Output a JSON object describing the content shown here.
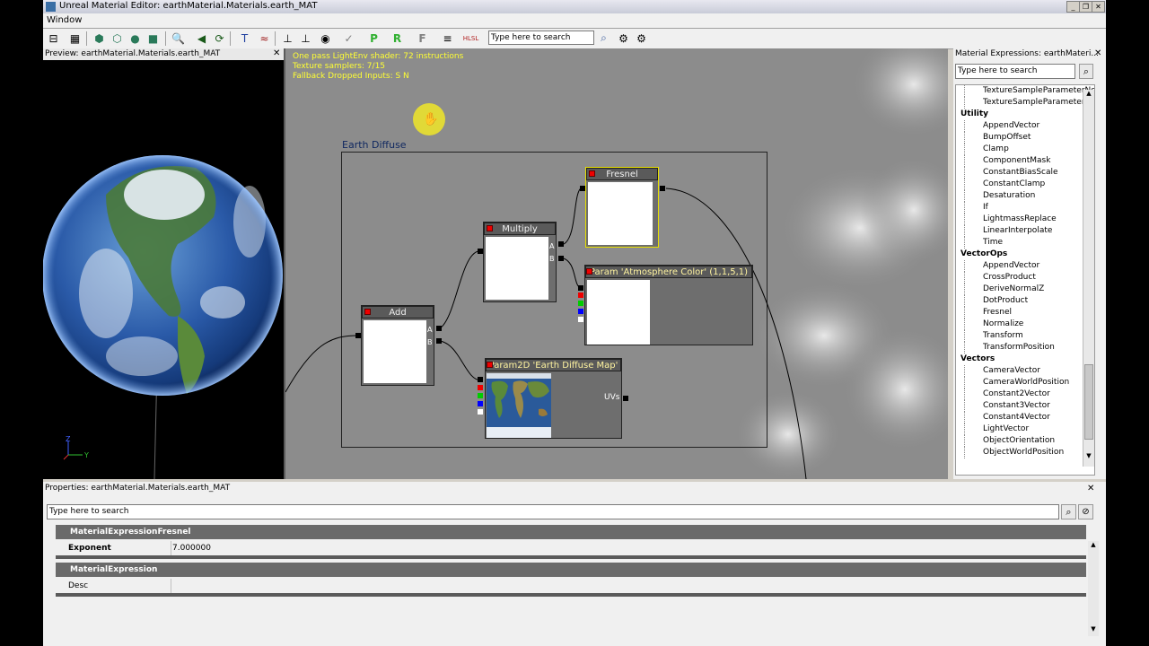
{
  "window": {
    "title": "Unreal Material Editor: earthMaterial.Materials.earth_MAT",
    "menu": [
      "Window"
    ]
  },
  "toolbar": {
    "search_placeholder": "Type here to search"
  },
  "preview": {
    "title": "Preview: earthMaterial.Materials.earth_MAT",
    "axis_z": "Z",
    "axis_y": "Y"
  },
  "graph": {
    "info_lines": [
      "One pass LightEnv shader: 72 instructions",
      "Texture samplers: 7/15",
      "Fallback Dropped Inputs: S N"
    ],
    "comment": "Earth Diffuse",
    "nodes": {
      "fresnel": "Fresnel",
      "multiply": "Multiply",
      "add": "Add",
      "atmos": "Param 'Atmosphere Color' (1,1,5,1)",
      "tex": "Param2D 'Earth Diffuse Map'",
      "tex_uvs": "UVs",
      "pin_a": "A",
      "pin_b": "B"
    }
  },
  "expressions": {
    "title": "Material Expressions: earthMateri...",
    "search_placeholder": "Type here to search",
    "rows": [
      {
        "t": "item",
        "label": "TextureSampleParameterNorm"
      },
      {
        "t": "item",
        "label": "TextureSampleParameterSubU"
      },
      {
        "t": "cat",
        "label": "Utility"
      },
      {
        "t": "item",
        "label": "AppendVector"
      },
      {
        "t": "item",
        "label": "BumpOffset"
      },
      {
        "t": "item",
        "label": "Clamp"
      },
      {
        "t": "item",
        "label": "ComponentMask"
      },
      {
        "t": "item",
        "label": "ConstantBiasScale"
      },
      {
        "t": "item",
        "label": "ConstantClamp"
      },
      {
        "t": "item",
        "label": "Desaturation"
      },
      {
        "t": "item",
        "label": "If"
      },
      {
        "t": "item",
        "label": "LightmassReplace"
      },
      {
        "t": "item",
        "label": "LinearInterpolate"
      },
      {
        "t": "item",
        "label": "Time"
      },
      {
        "t": "cat",
        "label": "VectorOps"
      },
      {
        "t": "item",
        "label": "AppendVector"
      },
      {
        "t": "item",
        "label": "CrossProduct"
      },
      {
        "t": "item",
        "label": "DeriveNormalZ"
      },
      {
        "t": "item",
        "label": "DotProduct"
      },
      {
        "t": "item",
        "label": "Fresnel"
      },
      {
        "t": "item",
        "label": "Normalize"
      },
      {
        "t": "item",
        "label": "Transform"
      },
      {
        "t": "item",
        "label": "TransformPosition"
      },
      {
        "t": "cat",
        "label": "Vectors"
      },
      {
        "t": "item",
        "label": "CameraVector"
      },
      {
        "t": "item",
        "label": "CameraWorldPosition"
      },
      {
        "t": "item",
        "label": "Constant2Vector"
      },
      {
        "t": "item",
        "label": "Constant3Vector"
      },
      {
        "t": "item",
        "label": "Constant4Vector"
      },
      {
        "t": "item",
        "label": "LightVector"
      },
      {
        "t": "item",
        "label": "ObjectOrientation"
      },
      {
        "t": "item",
        "label": "ObjectWorldPosition"
      }
    ]
  },
  "properties": {
    "title": "Properties: earthMaterial.Materials.earth_MAT",
    "search_placeholder": "Type here to search",
    "section1": "MaterialExpressionFresnel",
    "exponent_label": "Exponent",
    "exponent_value": "7.000000",
    "section2": "MaterialExpression",
    "desc_label": "Desc",
    "desc_value": ""
  },
  "colors": {
    "accent_yellow": "#ffff33",
    "node_header": "#5a5a5a",
    "selected_border": "#e8e000"
  }
}
